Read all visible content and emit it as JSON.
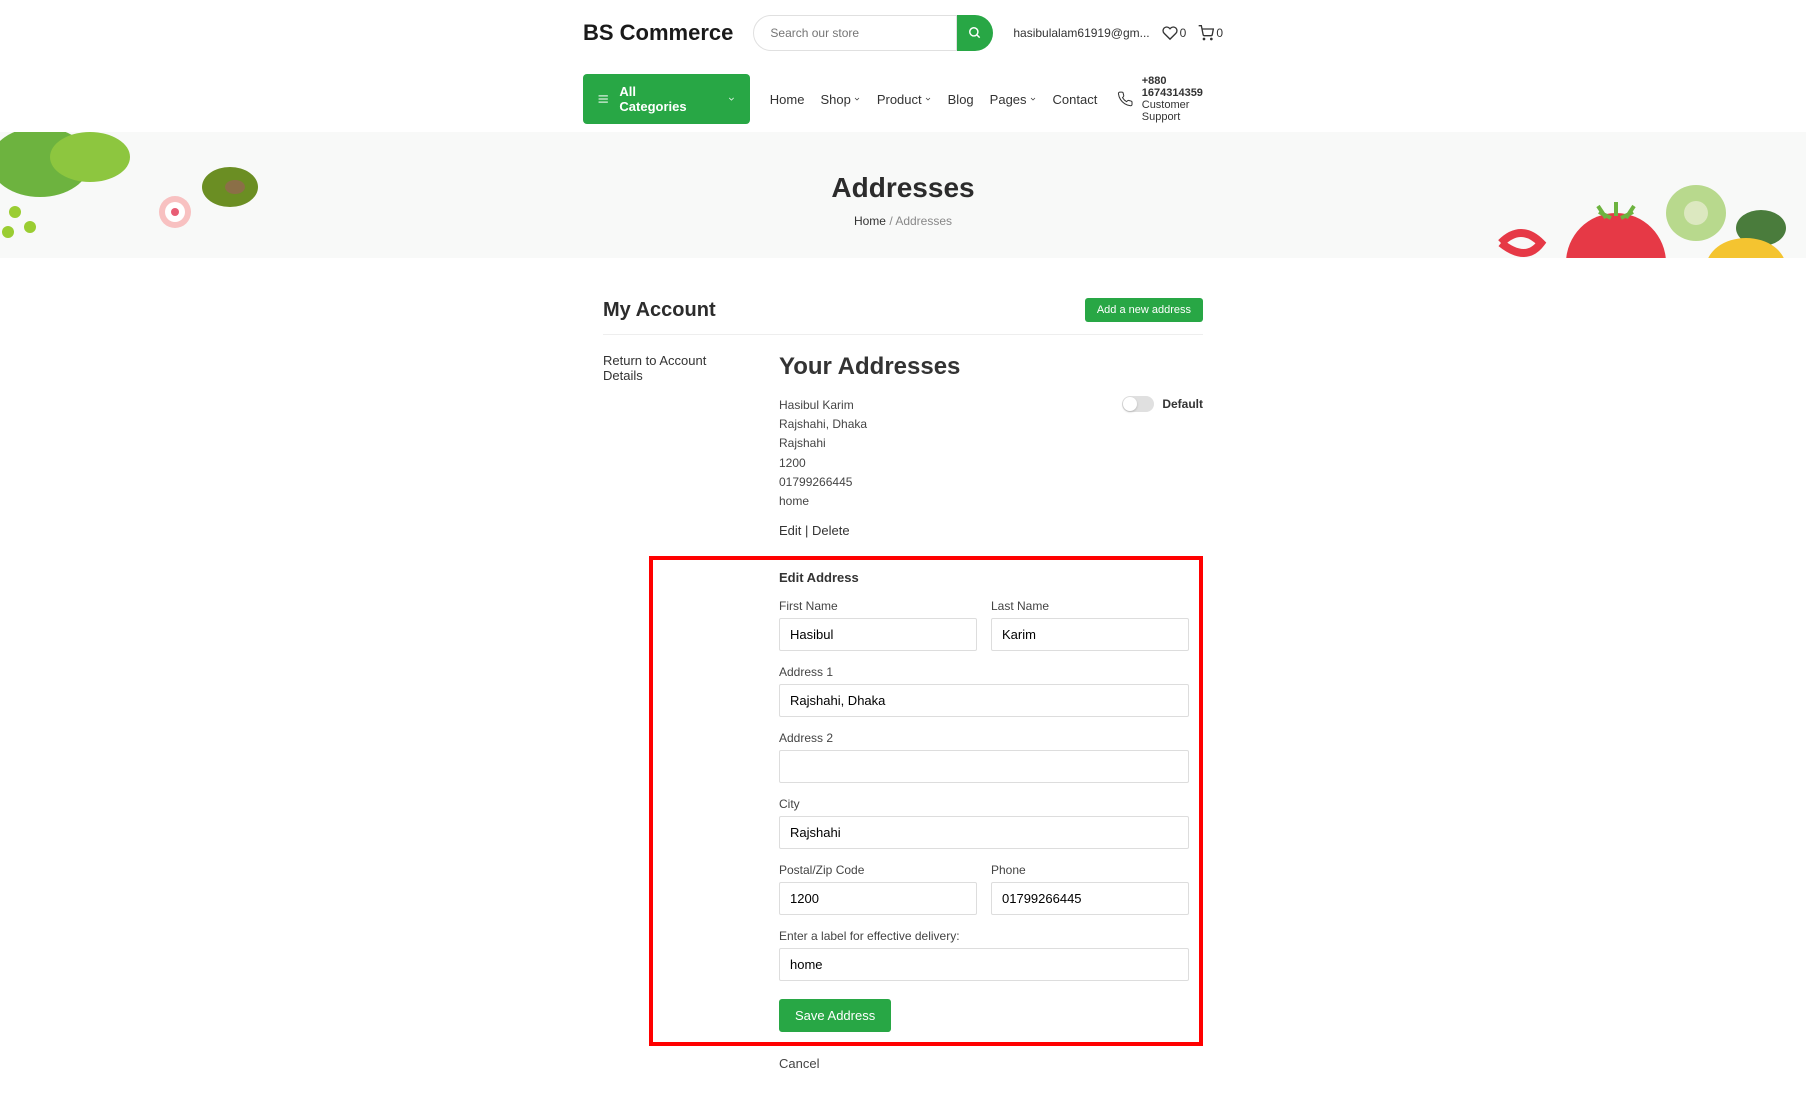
{
  "header": {
    "logo": "BS Commerce",
    "search_placeholder": "Search our store",
    "user_email": "hasibulalam61919@gm...",
    "wishlist_count": "0",
    "cart_count": "0"
  },
  "nav": {
    "categories_label": "All Categories",
    "links": [
      "Home",
      "Shop",
      "Product",
      "Blog",
      "Pages",
      "Contact"
    ],
    "support_phone": "+880 1674314359",
    "support_label": "Customer Support"
  },
  "banner": {
    "title": "Addresses",
    "breadcrumb_home": "Home",
    "breadcrumb_current": "Addresses"
  },
  "account": {
    "title": "My Account",
    "add_button": "Add a new address",
    "return_link": "Return to Account Details"
  },
  "addresses": {
    "title": "Your Addresses",
    "default_label": "Default",
    "name": "Hasibul Karim",
    "line1": "Rajshahi, Dhaka",
    "city": "Rajshahi",
    "postal": "1200",
    "phone": "01799266445",
    "tag": "home",
    "edit_label": "Edit",
    "delete_label": "Delete"
  },
  "edit_form": {
    "title": "Edit Address",
    "first_name_label": "First Name",
    "first_name_value": "Hasibul",
    "last_name_label": "Last Name",
    "last_name_value": "Karim",
    "address1_label": "Address 1",
    "address1_value": "Rajshahi, Dhaka",
    "address2_label": "Address 2",
    "address2_value": "",
    "city_label": "City",
    "city_value": "Rajshahi",
    "postal_label": "Postal/Zip Code",
    "postal_value": "1200",
    "phone_label": "Phone",
    "phone_value": "01799266445",
    "tag_label": "Enter a label for effective delivery:",
    "tag_value": "home",
    "save_button": "Save Address",
    "cancel_label": "Cancel"
  }
}
